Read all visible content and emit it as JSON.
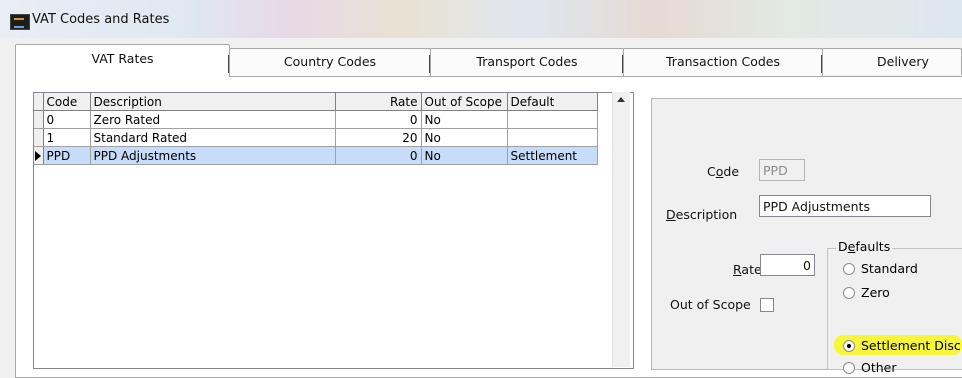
{
  "window": {
    "title": "VAT Codes and Rates",
    "icon": "app-icon"
  },
  "tabs": [
    {
      "label": "VAT Rates",
      "active": true
    },
    {
      "label": "Country Codes"
    },
    {
      "label": "Transport Codes"
    },
    {
      "label": "Transaction Codes"
    },
    {
      "label": "Delivery Code"
    }
  ],
  "grid": {
    "columns": [
      "Code",
      "Description",
      "Rate",
      "Out of Scope",
      "Default"
    ],
    "rows": [
      {
        "code": "0",
        "description": "Zero Rated",
        "rate": "0",
        "out_of_scope": "No",
        "default": ""
      },
      {
        "code": "1",
        "description": "Standard Rated",
        "rate": "20",
        "out_of_scope": "No",
        "default": ""
      },
      {
        "code": "PPD",
        "description": "PPD Adjustments",
        "rate": "0",
        "out_of_scope": "No",
        "default": "Settlement",
        "selected": true
      }
    ]
  },
  "detail": {
    "code_label_pre": "C",
    "code_label_u": "o",
    "code_label_post": "de",
    "code_value": "PPD",
    "desc_label_u": "D",
    "desc_label_post": "escription",
    "desc_value": "PPD Adjustments",
    "rate_label_u": "R",
    "rate_label_post": "ate",
    "rate_value": "0",
    "out_of_scope_label": "Out of Scope",
    "out_of_scope_checked": false,
    "defaults_title_pre": "D",
    "defaults_title_u": "e",
    "defaults_title_post": "faults",
    "options": [
      "Standard",
      "Zero",
      "Settlement Disc",
      "Other"
    ],
    "selected_option": "Settlement Disc",
    "highlight_color": "#f7f63a"
  },
  "colors": {
    "selected_row": "#c6dcf8",
    "panel_bg": "#f0f0f0"
  }
}
